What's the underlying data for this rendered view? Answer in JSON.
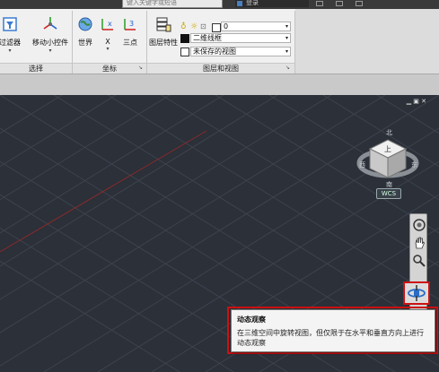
{
  "title_bar": {
    "search_placeholder": "键入关键字或短语",
    "user_label": "登录"
  },
  "ribbon": {
    "filter_label": "过滤器",
    "gizmo_label": "移动小控件",
    "panel_select": "选择",
    "world_label": "世界",
    "x_label": "X",
    "three_point_label": "三点",
    "panel_coords": "坐标",
    "layer_props_label": "图层特性",
    "layer_dropdown_value": "0",
    "visual_style_value": "二维线框",
    "view_value": "未保存的视图",
    "panel_layers_view": "图层和视图"
  },
  "viewcube": {
    "face_label": "上",
    "wcs_label": "WCS"
  },
  "tooltip": {
    "title": "动态观察",
    "description": "在三维空间中旋转视图，但仅限于在水平和垂直方向上进行动态观察"
  },
  "colors": {
    "viewport_bg": "#2b3039",
    "highlight_red": "#cc1111",
    "ribbon_bg": "#f0f0f0"
  }
}
